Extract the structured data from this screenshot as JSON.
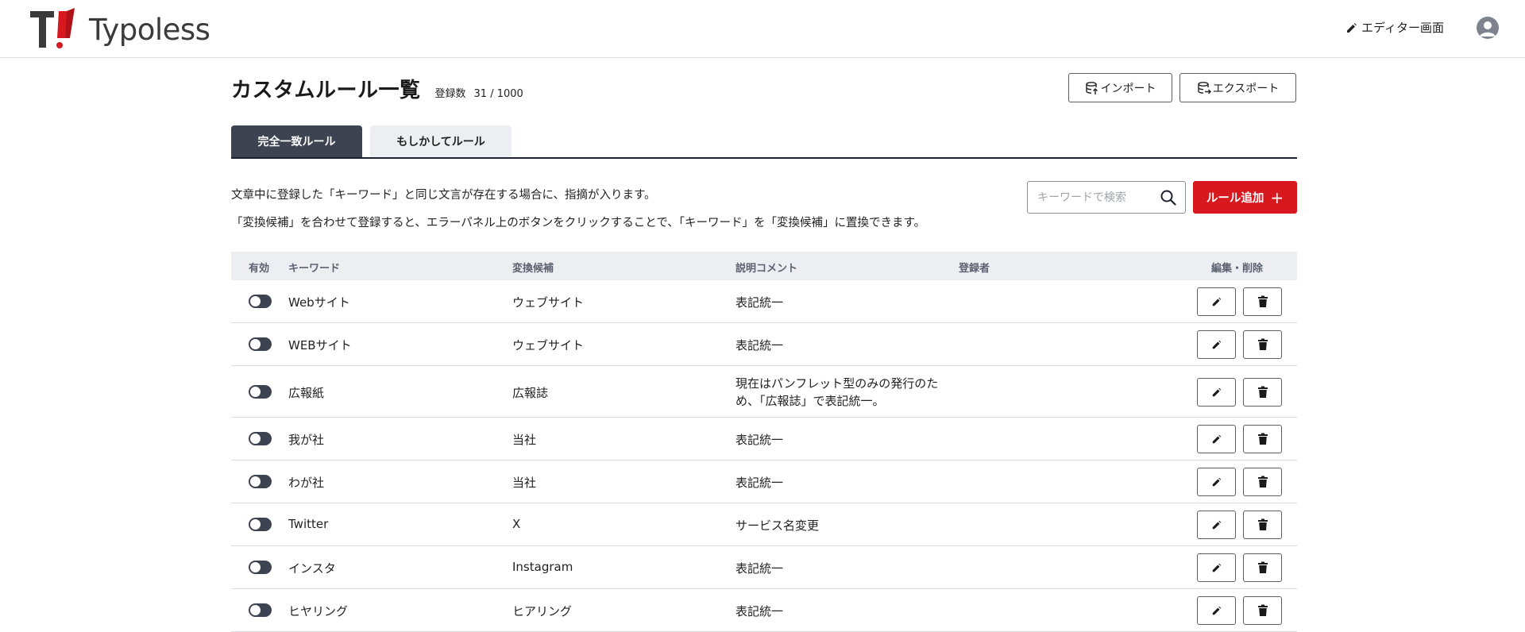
{
  "header": {
    "brand": "Typoless",
    "editor_link": "エディター画面"
  },
  "page": {
    "title": "カスタムルール一覧",
    "count_label": "登録数",
    "count_value": "31 / 1000",
    "import_label": "インポート",
    "export_label": "エクスポート"
  },
  "tabs": [
    {
      "label": "完全一致ルール",
      "active": true
    },
    {
      "label": "もしかしてルール",
      "active": false
    }
  ],
  "description": {
    "line1": "文章中に登録した「キーワード」と同じ文言が存在する場合に、指摘が入ります。",
    "line2": "「変換候補」を合わせて登録すると、エラーパネル上のボタンをクリックすることで、「キーワード」を「変換候補」に置換できます。"
  },
  "search": {
    "placeholder": "キーワードで検索",
    "value": ""
  },
  "add_button": {
    "label": "ルール追加",
    "icon": "plus-icon"
  },
  "table": {
    "columns": {
      "enabled": "有効",
      "keyword": "キーワード",
      "candidate": "変換候補",
      "comment": "説明コメント",
      "registrant": "登録者",
      "actions": "編集・削除"
    },
    "rows": [
      {
        "enabled": true,
        "keyword": "Webサイト",
        "candidate": "ウェブサイト",
        "comment_line1": "表記統一",
        "comment_line2": "",
        "registrant": ""
      },
      {
        "enabled": true,
        "keyword": "WEBサイト",
        "candidate": "ウェブサイト",
        "comment_line1": "表記統一",
        "comment_line2": "",
        "registrant": ""
      },
      {
        "enabled": true,
        "keyword": "広報紙",
        "candidate": "広報誌",
        "comment_line1": "現在はパンフレット型のみの発行のた",
        "comment_line2": "め、「広報誌」で表記統一。",
        "registrant": ""
      },
      {
        "enabled": true,
        "keyword": "我が社",
        "candidate": "当社",
        "comment_line1": "表記統一",
        "comment_line2": "",
        "registrant": ""
      },
      {
        "enabled": true,
        "keyword": "わが社",
        "candidate": "当社",
        "comment_line1": "表記統一",
        "comment_line2": "",
        "registrant": ""
      },
      {
        "enabled": true,
        "keyword": "Twitter",
        "candidate": "X",
        "comment_line1": "サービス名変更",
        "comment_line2": "",
        "registrant": ""
      },
      {
        "enabled": true,
        "keyword": "インスタ",
        "candidate": "Instagram",
        "comment_line1": "表記統一",
        "comment_line2": "",
        "registrant": ""
      },
      {
        "enabled": true,
        "keyword": "ヒヤリング",
        "candidate": "ヒアリング",
        "comment_line1": "表記統一",
        "comment_line2": "",
        "registrant": ""
      }
    ]
  },
  "colors": {
    "accent_red": "#d7191f",
    "dark_navy": "#3e4352",
    "header_bg": "#eceef1"
  }
}
